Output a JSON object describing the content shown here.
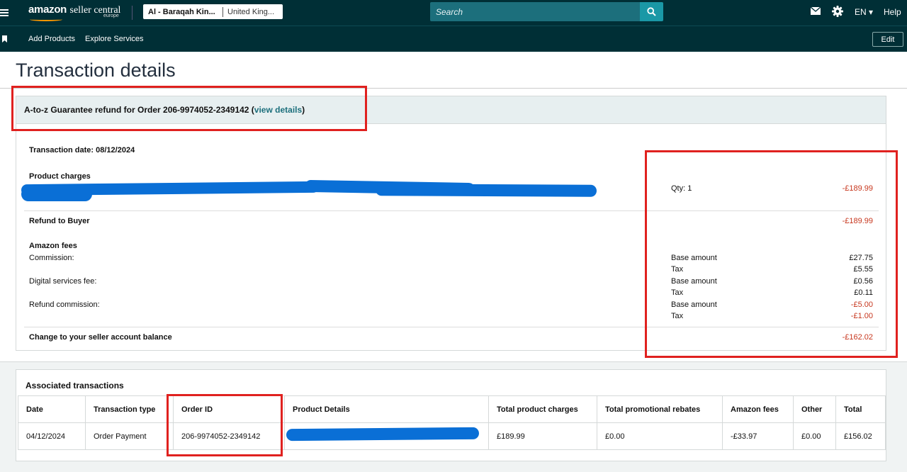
{
  "topbar": {
    "logo_amazon": "amazon",
    "logo_product": "seller central",
    "logo_region": "europe",
    "account_name": "Al - Baraqah Kin...",
    "marketplace": "United King...",
    "search_placeholder": "Search",
    "language": "EN ▾",
    "help": "Help",
    "icons": [
      "menu-icon",
      "mail-icon",
      "gear-icon",
      "search-icon"
    ]
  },
  "navbar": {
    "items": [
      "Add Products",
      "Explore Services"
    ],
    "edit_label": "Edit"
  },
  "page": {
    "title": "Transaction details"
  },
  "transaction": {
    "heading_prefix": "A-to-z Guarantee refund for Order 206-9974052-2349142 (",
    "heading_link": "view details",
    "heading_suffix": ")",
    "date_label": "Transaction date: 08/12/2024",
    "product_charges_label": "Product charges",
    "qty": "Qty: 1",
    "product_amount": "-£189.99",
    "refund_label": "Refund to Buyer",
    "refund_amount": "-£189.99",
    "fees_label": "Amazon fees",
    "fees": [
      {
        "label": "Commission:",
        "link": false,
        "lines": [
          {
            "name": "Base amount",
            "amount": "£27.75",
            "negative": false
          },
          {
            "name": "Tax",
            "amount": "£5.55",
            "negative": false
          }
        ]
      },
      {
        "label": "Digital services fee:",
        "link": false,
        "lines": [
          {
            "name": "Base amount",
            "amount": "£0.56",
            "negative": false
          },
          {
            "name": "Tax",
            "amount": "£0.11",
            "negative": false
          }
        ]
      },
      {
        "label": "Refund commission:",
        "link": true,
        "lines": [
          {
            "name": "Base amount",
            "amount": "-£5.00",
            "negative": true
          },
          {
            "name": "Tax",
            "amount": "-£1.00",
            "negative": true
          }
        ]
      }
    ],
    "balance_label": "Change to your seller account balance",
    "balance_amount": "-£162.02"
  },
  "associated": {
    "title": "Associated transactions",
    "columns": [
      "Date",
      "Transaction type",
      "Order ID",
      "Product Details",
      "Total product charges",
      "Total promotional rebates",
      "Amazon fees",
      "Other",
      "Total"
    ],
    "rows": [
      {
        "date": "04/12/2024",
        "type": "Order Payment",
        "order_id": "206-9974052-2349142",
        "product": "",
        "charges": "£189.99",
        "rebates": "£0.00",
        "fees": "-£33.97",
        "other": "£0.00",
        "total": "£156.02"
      }
    ]
  },
  "colors": {
    "header_bg": "#002f36",
    "link": "#1c6f7c",
    "negative": "#c7361d",
    "highlight_box": "#e0211f",
    "redaction": "#0a6fd6"
  }
}
